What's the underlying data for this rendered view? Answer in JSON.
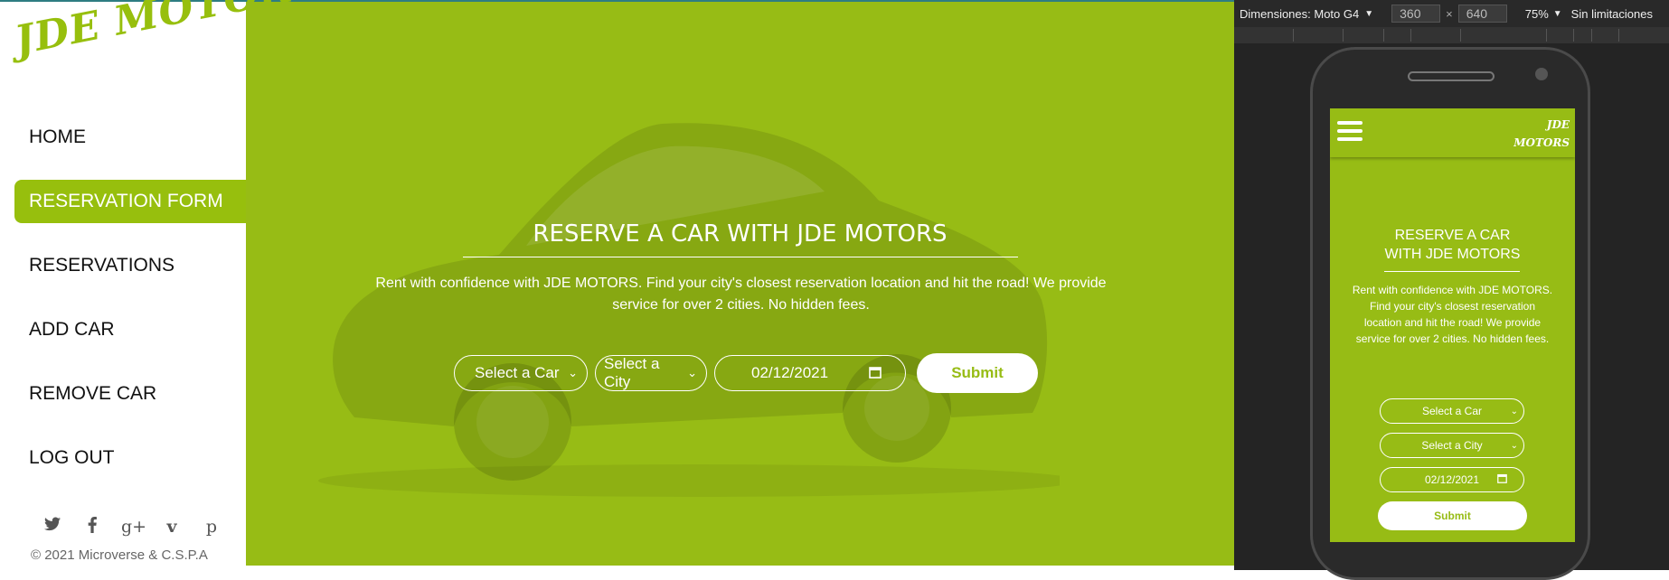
{
  "brand": {
    "logo": "JDE MOTORS",
    "accent_color": "#97bf0d",
    "hero_color": "#97bc15"
  },
  "sidebar": {
    "items": [
      {
        "label": "HOME",
        "active": false
      },
      {
        "label": "RESERVATION FORM",
        "active": true
      },
      {
        "label": "RESERVATIONS",
        "active": false
      },
      {
        "label": "ADD CAR",
        "active": false
      },
      {
        "label": "REMOVE CAR",
        "active": false
      },
      {
        "label": "LOG OUT",
        "active": false
      }
    ],
    "social_icons": [
      "twitter-icon",
      "facebook-icon",
      "google-plus-icon",
      "vimeo-icon",
      "pinterest-icon"
    ],
    "footer": "© 2021 Microverse & C.S.P.A"
  },
  "hero": {
    "title": "RESERVE A CAR WITH JDE MOTORS",
    "description": "Rent with confidence with JDE MOTORS. Find your city's closest reservation location and hit the road! We provide service for over 2 cities. No hidden fees.",
    "car_select": "Select a Car",
    "city_select": "Select a City",
    "date_value": "02/12/2021",
    "submit_label": "Submit"
  },
  "devtools": {
    "dimensions_label": "Dimensiones: Moto G4",
    "width": "360",
    "times": "×",
    "height": "640",
    "zoom": "75%",
    "throttle": "Sin limitaciones"
  },
  "mobile": {
    "logo_line1": "JDE",
    "logo_line2": "MOTORS",
    "title_line1": "RESERVE A CAR",
    "title_line2": "WITH JDE MOTORS",
    "description": "Rent with confidence with JDE MOTORS. Find your city's closest reservation location and hit the road! We provide service for over 2 cities. No hidden fees.",
    "car_select": "Select a Car",
    "city_select": "Select a City",
    "date_value": "02/12/2021",
    "submit_label": "Submit"
  }
}
